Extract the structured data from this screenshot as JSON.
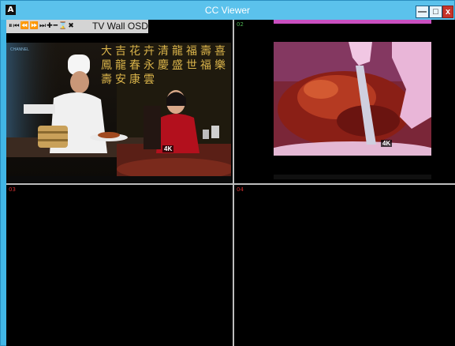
{
  "window": {
    "title": "CC Viewer",
    "app_icon": "A",
    "buttons": {
      "minimize": "—",
      "maximize": "□",
      "close": "x"
    }
  },
  "osd": {
    "title": "TV Wall OSD",
    "icons": [
      "pause-icon",
      "skip-back-icon",
      "rewind-icon",
      "forward-icon",
      "skip-forward-icon",
      "plus-icon",
      "minus-icon",
      "hourglass-icon",
      "close-icon"
    ],
    "icon_glyphs": "⏸⏮⏪⏩⏭✚━⌛✖"
  },
  "tiles": [
    {
      "label": "",
      "label_color": "#ffffff",
      "content": "video"
    },
    {
      "label": "02",
      "label_color": "#4caf50",
      "content": "video"
    },
    {
      "label": "03",
      "label_color": "#d32f2f",
      "content": "empty"
    },
    {
      "label": "04",
      "label_color": "#d32f2f",
      "content": "empty"
    }
  ],
  "scene1": {
    "chars": "大吉花卉清龍福壽喜鳳龍春永慶盛世福樂壽安康雲",
    "logo": "4K",
    "channel": "CHANNEL"
  },
  "scene2": {
    "logo": "4K"
  },
  "colors": {
    "window_frame": "#41b6e6",
    "title_text": "#ffffff",
    "close_button": "#c7352b"
  }
}
